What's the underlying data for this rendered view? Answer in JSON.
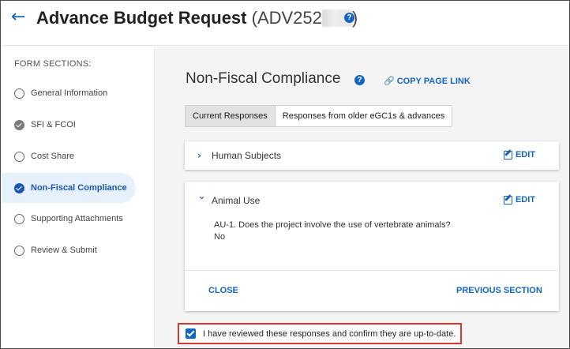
{
  "header": {
    "back_icon": "arrow-left-icon",
    "title": "Advance Budget Request",
    "id_prefix": "(ADV252",
    "id_suffix": ")",
    "help_icon": "question-circle-icon",
    "help_glyph": "?"
  },
  "sidebar": {
    "heading": "FORM SECTIONS:",
    "items": [
      {
        "label": "General Information",
        "status": "empty"
      },
      {
        "label": "SFI & FCOI",
        "status": "done"
      },
      {
        "label": "Cost Share",
        "status": "empty"
      },
      {
        "label": "Non-Fiscal Compliance",
        "status": "active"
      },
      {
        "label": "Supporting Attachments",
        "status": "empty"
      },
      {
        "label": "Review & Submit",
        "status": "empty"
      }
    ]
  },
  "main": {
    "section_title": "Non-Fiscal Compliance",
    "help_glyph": "?",
    "copy_link_label": "COPY PAGE LINK",
    "copy_link_icon": "link-icon",
    "tabs": [
      {
        "label": "Current Responses",
        "active": true
      },
      {
        "label": "Responses from older eGC1s & advances",
        "active": false
      }
    ],
    "cards": [
      {
        "title": "Human Subjects",
        "expanded": false,
        "edit_label": "EDIT"
      },
      {
        "title": "Animal Use",
        "expanded": true,
        "edit_label": "EDIT",
        "question": "AU-1. Does the project involve the use of vertebrate animals?",
        "answer": "No",
        "close_label": "CLOSE",
        "previous_label": "PREVIOUS SECTION"
      }
    ],
    "confirm": {
      "checked": true,
      "text": "I have reviewed these responses and confirm they are up-to-date."
    }
  },
  "colors": {
    "accent": "#1565c0",
    "active_nav_bg": "#e7f1fc",
    "confirm_border": "#d9362f",
    "main_bg": "#f4f4f4"
  }
}
